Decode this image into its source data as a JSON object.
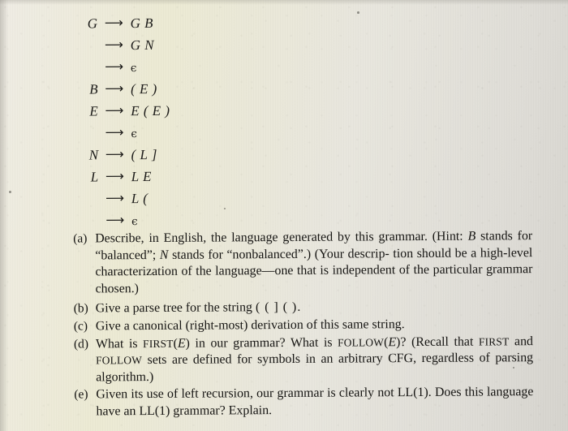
{
  "document": {
    "type": "textbook-exercise-scan",
    "page_background_color": "#e8e6de",
    "ink_color": "#1d1c1a"
  },
  "grammar": {
    "arrow_glyph": "⟶",
    "epsilon_glyph": "ϵ",
    "productions": [
      {
        "lhs": "G",
        "arrow": "⟶",
        "rhs": "G B",
        "rhs_plain": "G B"
      },
      {
        "lhs": "",
        "arrow": "⟶",
        "rhs": "G N",
        "rhs_plain": "G N"
      },
      {
        "lhs": "",
        "arrow": "⟶",
        "rhs": "ϵ",
        "rhs_plain": "epsilon"
      },
      {
        "lhs": "B",
        "arrow": "⟶",
        "rhs": "( E )",
        "rhs_plain": "( E )"
      },
      {
        "lhs": "E",
        "arrow": "⟶",
        "rhs": "E ( E )",
        "rhs_plain": "E ( E )"
      },
      {
        "lhs": "",
        "arrow": "⟶",
        "rhs": "ϵ",
        "rhs_plain": "epsilon"
      },
      {
        "lhs": "N",
        "arrow": "⟶",
        "rhs": "( L ]",
        "rhs_plain": "( L ]"
      },
      {
        "lhs": "L",
        "arrow": "⟶",
        "rhs": "L E",
        "rhs_plain": "L E"
      },
      {
        "lhs": "",
        "arrow": "⟶",
        "rhs": "L (",
        "rhs_plain": "L ("
      },
      {
        "lhs": "",
        "arrow": "⟶",
        "rhs": "ϵ",
        "rhs_plain": "epsilon"
      }
    ]
  },
  "exercise": {
    "items": [
      {
        "label": "(a)",
        "text": "Describe, in English, the language generated by this grammar. (Hint: B stands for “balanced”; N stands for “nonbalanced”.) (Your description should be a high-level characterization of the language—one that is independent of the particular grammar chosen.)"
      },
      {
        "label": "(b)",
        "text": "Give a parse tree for the string ( ( ] ( ) ."
      },
      {
        "label": "(c)",
        "text": "Give a canonical (right-most) derivation of this same string."
      },
      {
        "label": "(d)",
        "text": "What is FIRST(E) in our grammar? What is FOLLOW(E)? (Recall that FIRST and FOLLOW sets are defined for symbols in an arbitrary CFG, regardless of parsing algorithm.)"
      },
      {
        "label": "(e)",
        "text": "Given its use of left recursion, our grammar is clearly not LL(1). Does this language have an LL(1) grammar? Explain."
      }
    ],
    "item_a_parts": {
      "p1": "Describe, in English, the language generated by this grammar. (Hint:",
      "p2_italic_B": "B",
      "p2_rest": " stands for “balanced”; ",
      "p2_italic_N": "N",
      "p2_rest2": " stands for “nonbalanced”.) (Your descrip-",
      "p3": "tion should be a high-level characterization of the language—one that",
      "p4": "is independent of the particular grammar chosen.)"
    },
    "item_b_parts": {
      "pre": "Give a parse tree for the string ",
      "string": "( ( ] ( )",
      "post": "."
    },
    "item_c_parts": {
      "text": "Give a canonical (right-most) derivation of this same string."
    },
    "item_d_parts": {
      "p1_pre": "What is ",
      "p1_first": "FIRST",
      "p1_mid": "(",
      "p1_e1": "E",
      "p1_mid2": ") in our grammar? What is ",
      "p1_follow": "FOLLOW",
      "p1_mid3": "(",
      "p1_e2": "E",
      "p1_end": ")? (Recall that",
      "p2_first": "FIRST",
      "p2_mid": " and ",
      "p2_follow": "FOLLOW",
      "p2_end": " sets are defined for symbols in an arbitrary CFG,",
      "p3": "regardless of parsing algorithm.)"
    },
    "item_e_parts": {
      "p1": "Given its use of left recursion, our grammar is clearly not LL(1). Does",
      "p2": "this language have an LL(1) grammar? Explain."
    }
  }
}
